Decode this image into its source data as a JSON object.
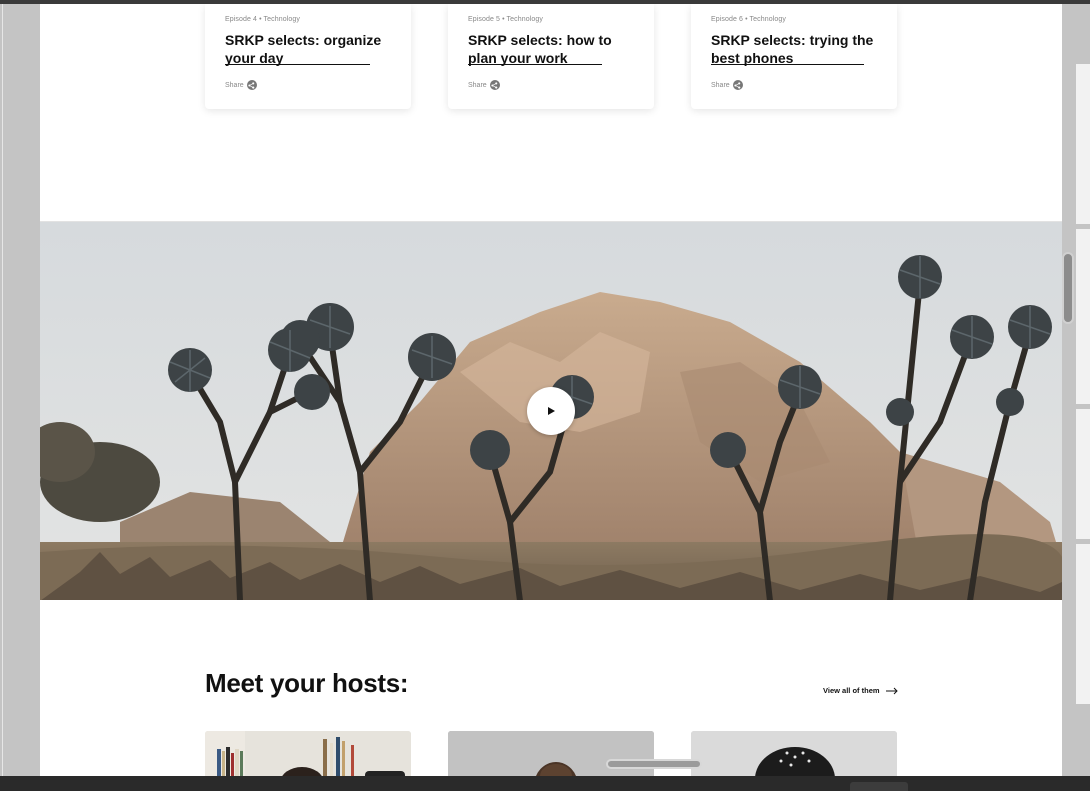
{
  "episodes": [
    {
      "meta": "Episode 4 • Technology",
      "title": "SRKP selects: organize your day",
      "share": "Share"
    },
    {
      "meta": "Episode 5 • Technology",
      "title": "SRKP selects: how to plan your work",
      "share": "Share"
    },
    {
      "meta": "Episode 6 • Technology",
      "title": "SRKP selects: trying the best phones",
      "share": "Share"
    }
  ],
  "hero": {
    "play_icon": "play-icon"
  },
  "hosts": {
    "heading": "Meet your hosts:",
    "view_all": "View all of them",
    "view_all_icon": "arrow-right-icon"
  },
  "icons": {
    "share": "share-icon"
  },
  "colors": {
    "text": "#111111",
    "meta": "#888888",
    "page_bg": "#ffffff"
  }
}
